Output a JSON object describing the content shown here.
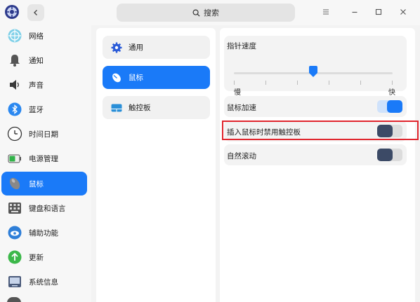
{
  "titlebar": {
    "search_placeholder": "搜索",
    "icons": [
      "app-logo",
      "back",
      "search",
      "menu",
      "minimize",
      "maximize",
      "close"
    ]
  },
  "nav": {
    "items": [
      {
        "label": "网络",
        "icon": "network-icon"
      },
      {
        "label": "通知",
        "icon": "bell-icon"
      },
      {
        "label": "声音",
        "icon": "speaker-icon"
      },
      {
        "label": "蓝牙",
        "icon": "bluetooth-icon"
      },
      {
        "label": "时间日期",
        "icon": "clock-icon"
      },
      {
        "label": "电源管理",
        "icon": "battery-icon"
      },
      {
        "label": "鼠标",
        "icon": "mouse-icon",
        "active": true
      },
      {
        "label": "键盘和语言",
        "icon": "keyboard-icon"
      },
      {
        "label": "辅助功能",
        "icon": "accessibility-icon"
      },
      {
        "label": "更新",
        "icon": "update-icon"
      },
      {
        "label": "系统信息",
        "icon": "system-info-icon"
      }
    ]
  },
  "subnav": {
    "items": [
      {
        "label": "通用",
        "icon": "gear-icon"
      },
      {
        "label": "鼠标",
        "icon": "mouse-icon",
        "active": true
      },
      {
        "label": "触控板",
        "icon": "touchpad-icon"
      }
    ]
  },
  "settings": {
    "pointer_speed": {
      "label": "指针速度",
      "min_label": "慢",
      "max_label": "快",
      "value": 0.5
    },
    "mouse_acceleration": {
      "label": "鼠标加速",
      "on": true
    },
    "disable_touchpad_on_mouse": {
      "label": "插入鼠标时禁用触控板",
      "on": false
    },
    "natural_scrolling": {
      "label": "自然滚动",
      "on": false
    }
  },
  "colors": {
    "accent": "#1a7af8",
    "toggle_off_knob": "#3c4a66",
    "highlight": "#e0252d"
  }
}
